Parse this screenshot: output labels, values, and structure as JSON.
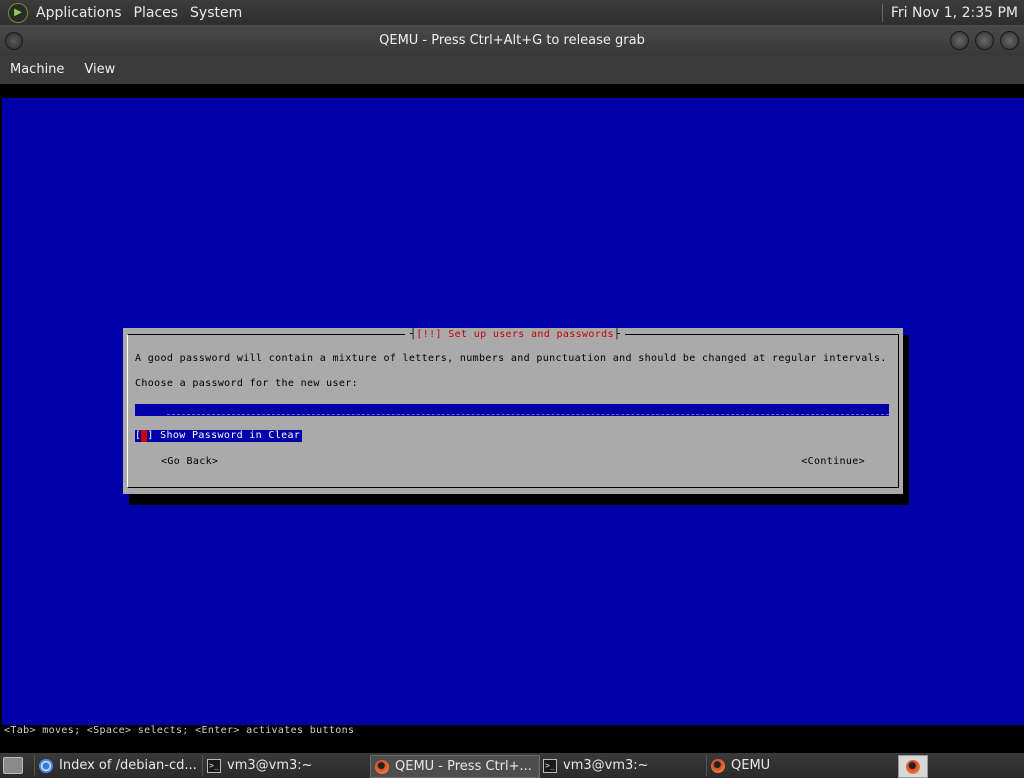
{
  "top_panel": {
    "menus": [
      "Applications",
      "Places",
      "System"
    ],
    "clock": "Fri Nov 1,  2:35 PM"
  },
  "window": {
    "title": "QEMU - Press Ctrl+Alt+G to release grab",
    "menus": [
      "Machine",
      "View"
    ]
  },
  "installer": {
    "dialog_title": "[!!] Set up users and passwords",
    "description": "A good password will contain a mixture of letters, numbers and punctuation and should be changed at regular intervals.",
    "prompt": "Choose a password for the new user:",
    "password_value": "****",
    "checkbox_label": "Show Password in Clear",
    "checkbox_checked": false,
    "back_button": "<Go Back>",
    "continue_button": "<Continue>",
    "help_line": "<Tab> moves; <Space> selects; <Enter> activates buttons"
  },
  "taskbar": {
    "tasks": [
      {
        "label": "Index of /debian-cd...",
        "icon": "chrome-icon"
      },
      {
        "label": "vm3@vm3:~",
        "icon": "terminal-icon"
      },
      {
        "label": "QEMU - Press Ctrl+...",
        "icon": "qemu-icon",
        "active": true
      },
      {
        "label": "vm3@vm3:~",
        "icon": "terminal-icon"
      },
      {
        "label": "QEMU",
        "icon": "qemu-icon"
      }
    ]
  },
  "colors": {
    "installer_background": "#0000a8",
    "dialog_background": "#aaaaaa",
    "dialog_title": "#c80000"
  }
}
